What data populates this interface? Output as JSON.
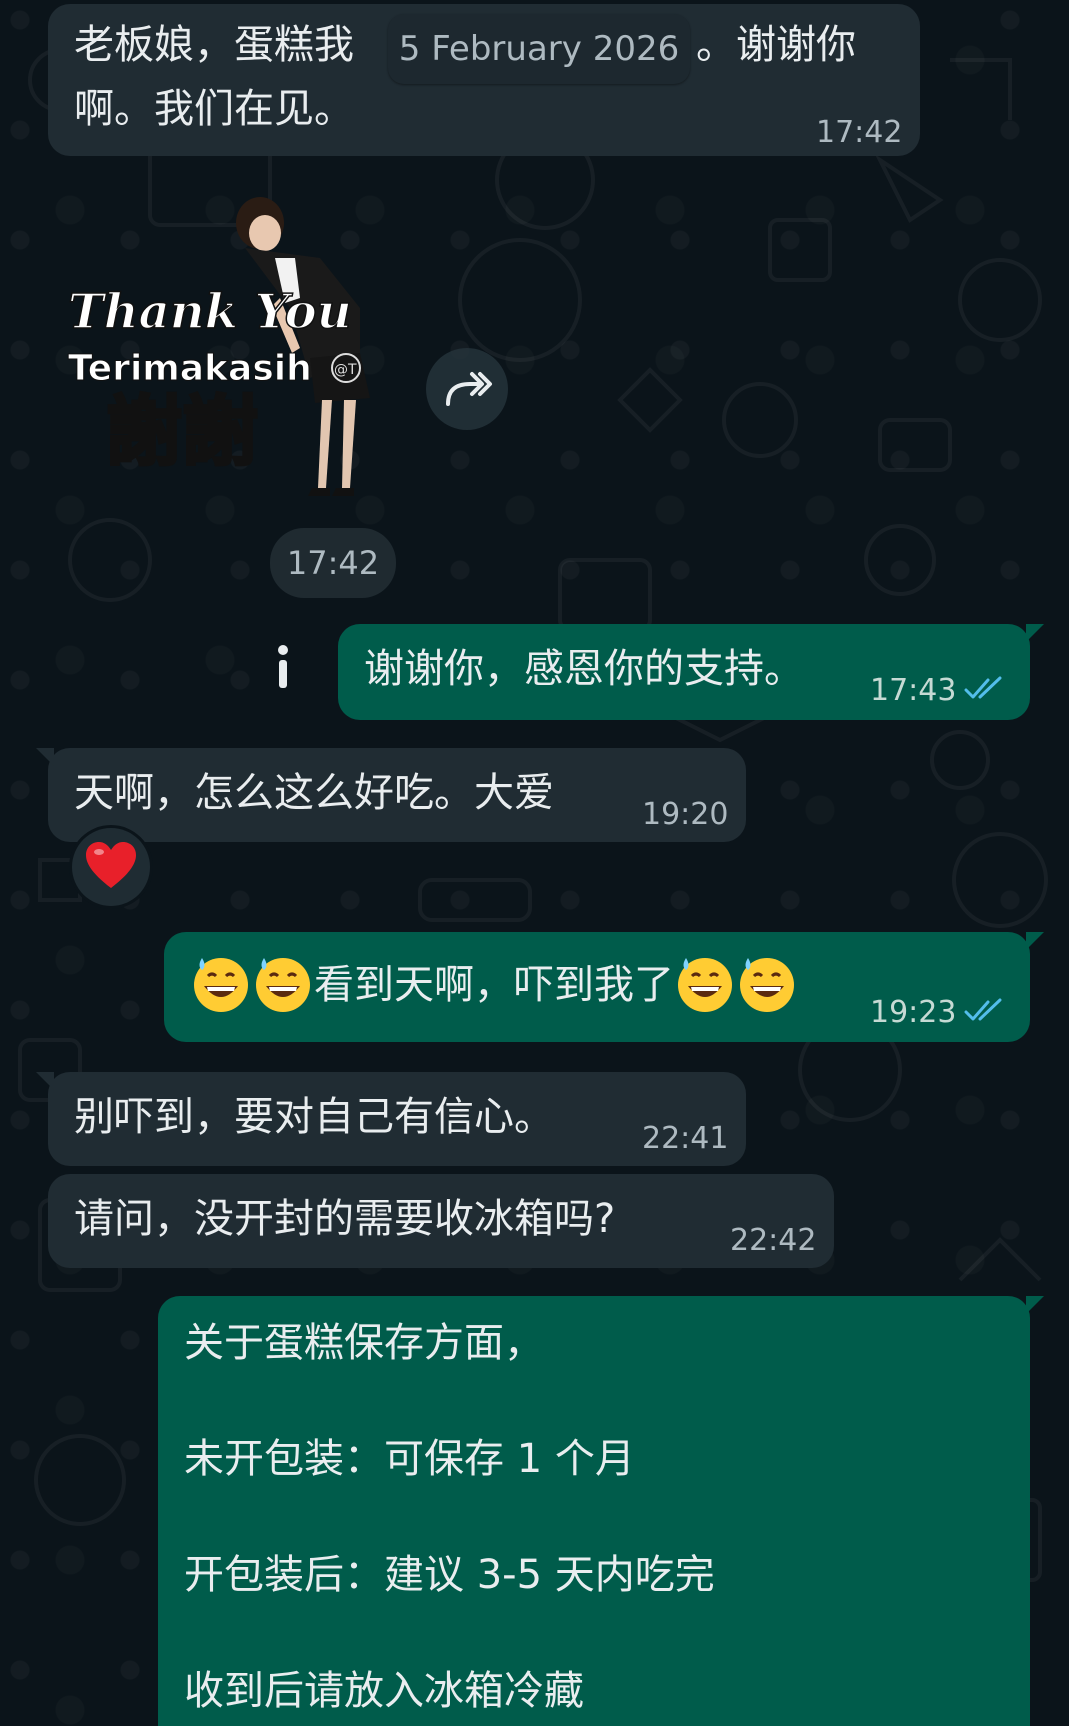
{
  "date_chip": "5 February 2026",
  "messages": [
    {
      "id": "m1",
      "direction": "incoming",
      "lines": [
        "老板娘，蛋糕我",
        "啊。我们在见。"
      ],
      "hidden_tail": "。谢谢你",
      "time": "17:42"
    },
    {
      "id": "m2",
      "direction": "incoming",
      "type": "sticker",
      "sticker_text": {
        "thank_you": "Thank You",
        "terimakasih": "Terimakasih",
        "xiexie": "謝謝",
        "watermark": "@T"
      },
      "time": "17:42"
    },
    {
      "id": "m3",
      "direction": "outgoing",
      "text": "谢谢你，感恩你的支持。",
      "time": "17:43",
      "status": "read"
    },
    {
      "id": "m4",
      "direction": "incoming",
      "text": "天啊，怎么这么好吃。大爱",
      "time": "19:20",
      "reaction": "red-heart"
    },
    {
      "id": "m5",
      "direction": "outgoing",
      "text_before": "",
      "text_middle": "看到天啊，吓到我了",
      "emoji": "grinning-face-with-sweat",
      "time": "19:23",
      "status": "read"
    },
    {
      "id": "m6",
      "direction": "incoming",
      "text": "别吓到，要对自己有信心。",
      "time": "22:41"
    },
    {
      "id": "m7",
      "direction": "incoming",
      "text": "请问，没开封的需要收冰箱吗?",
      "time": "22:42"
    },
    {
      "id": "m8",
      "direction": "outgoing",
      "lines": [
        "关于蛋糕保存方面，",
        "未开包装：可保存 1 个月",
        "开包装后：建议 3-5 天内吃完",
        "收到后请放入冰箱冷藏"
      ]
    }
  ],
  "colors": {
    "background": "#0b141a",
    "incoming_bubble": "#202c33",
    "outgoing_bubble": "#005c4b",
    "read_ticks": "#53bdeb",
    "text": "#e9edef",
    "time": "#aebac1"
  },
  "icons": {
    "forward": "forward-icon",
    "info": "info-icon",
    "read_receipt": "double-check-icon",
    "reaction": "red-heart-icon"
  }
}
